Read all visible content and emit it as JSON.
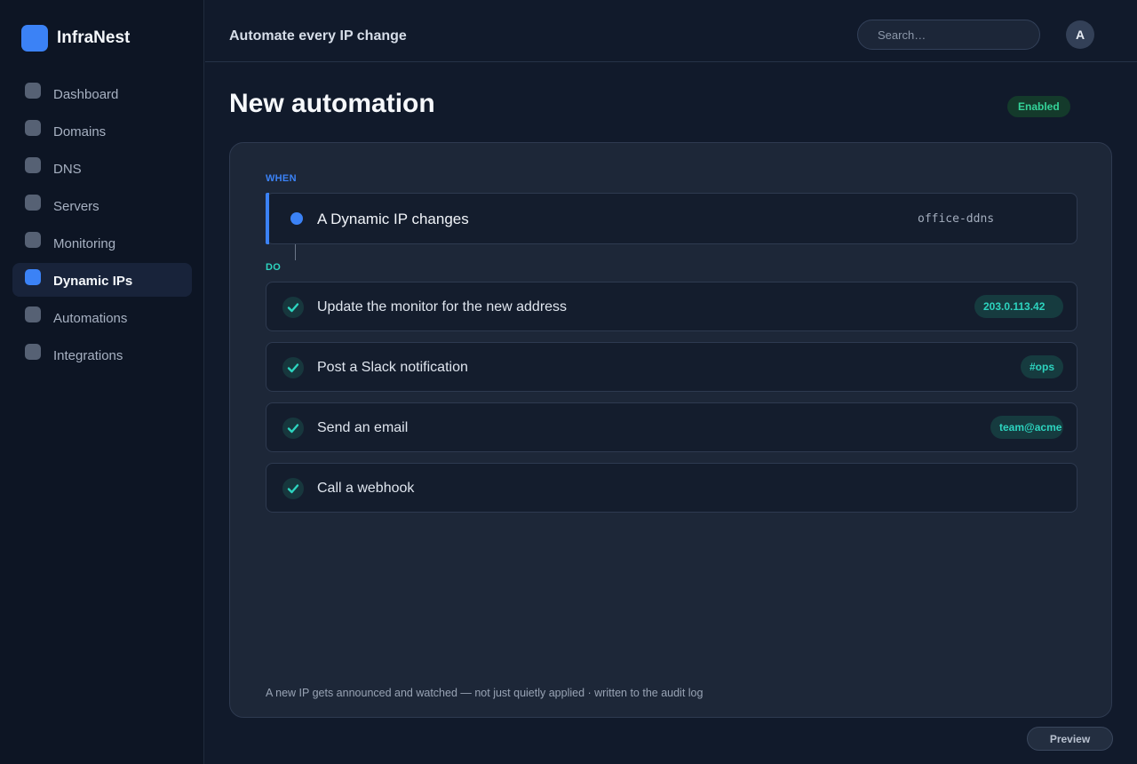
{
  "app": {
    "name": "InfraNest"
  },
  "sidebar": {
    "items": [
      {
        "label": "Dashboard",
        "active": false
      },
      {
        "label": "Domains",
        "active": false
      },
      {
        "label": "DNS",
        "active": false
      },
      {
        "label": "Servers",
        "active": false
      },
      {
        "label": "Monitoring",
        "active": false
      },
      {
        "label": "Dynamic IPs",
        "active": true
      },
      {
        "label": "Automations",
        "active": false
      },
      {
        "label": "Integrations",
        "active": false
      }
    ]
  },
  "header": {
    "title": "Automate every IP change",
    "search_placeholder": "Search…",
    "avatar_initial": "A"
  },
  "page": {
    "title": "New automation",
    "status": "Enabled"
  },
  "automation": {
    "when_label": "WHEN",
    "trigger": {
      "label": "A Dynamic IP changes",
      "source": "office-ddns"
    },
    "do_label": "DO",
    "actions": [
      {
        "label": "Update the monitor for the new address",
        "tag": "203.0.113.42"
      },
      {
        "label": "Post a Slack notification",
        "tag": "#ops"
      },
      {
        "label": "Send an email",
        "tag": "team@acme"
      },
      {
        "label": "Call a webhook",
        "tag": ""
      }
    ],
    "footnote": "A new IP gets announced and watched — not just quietly applied · written to the audit log"
  },
  "footer": {
    "preview_label": "Preview"
  },
  "colors": {
    "accent": "#3b82f6",
    "success": "#2dd4bf",
    "enabled": "#34d399"
  },
  "icons": {
    "action_check": "check-icon",
    "trigger_dot": "trigger-dot-icon"
  }
}
